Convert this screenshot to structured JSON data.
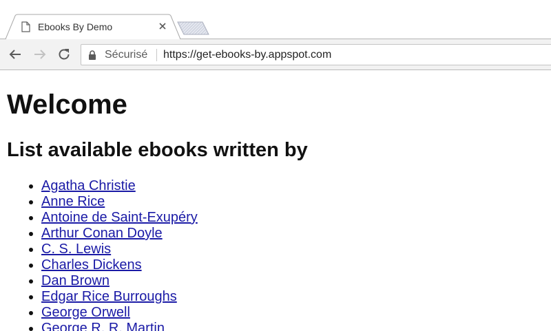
{
  "tab": {
    "title": "Ebooks By Demo"
  },
  "omnibox": {
    "security_label": "Sécurisé",
    "url": "https://get-ebooks-by.appspot.com"
  },
  "page": {
    "heading": "Welcome",
    "subheading": "List available ebooks written by",
    "authors": [
      "Agatha Christie",
      "Anne Rice",
      "Antoine de Saint-Exupéry",
      "Arthur Conan Doyle",
      "C. S. Lewis",
      "Charles Dickens",
      "Dan Brown",
      "Edgar Rice Burroughs",
      "George Orwell",
      "George R. R. Martin"
    ]
  },
  "colors": {
    "link": "#1a1aa6",
    "toolbar": "#f2f2f2"
  },
  "icons": {
    "favicon": "document-icon",
    "tab_close": "close-icon",
    "back": "back-arrow-icon",
    "forward": "forward-arrow-icon",
    "reload": "reload-icon",
    "lock": "lock-icon"
  }
}
